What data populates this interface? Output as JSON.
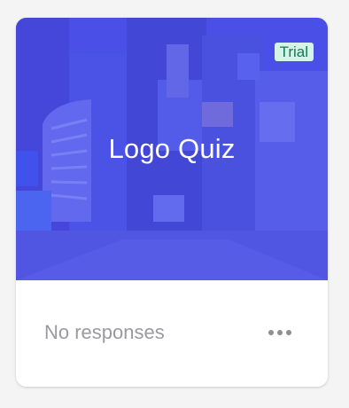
{
  "card": {
    "title": "Logo Quiz",
    "badge": "Trial",
    "responses_text": "No responses",
    "more_icon": "more-horizontal-icon"
  },
  "colors": {
    "cover_overlay": "#4a4fe8",
    "badge_bg": "#d5f3e6",
    "badge_text": "#137a52",
    "muted_text": "#9a9a9f"
  }
}
